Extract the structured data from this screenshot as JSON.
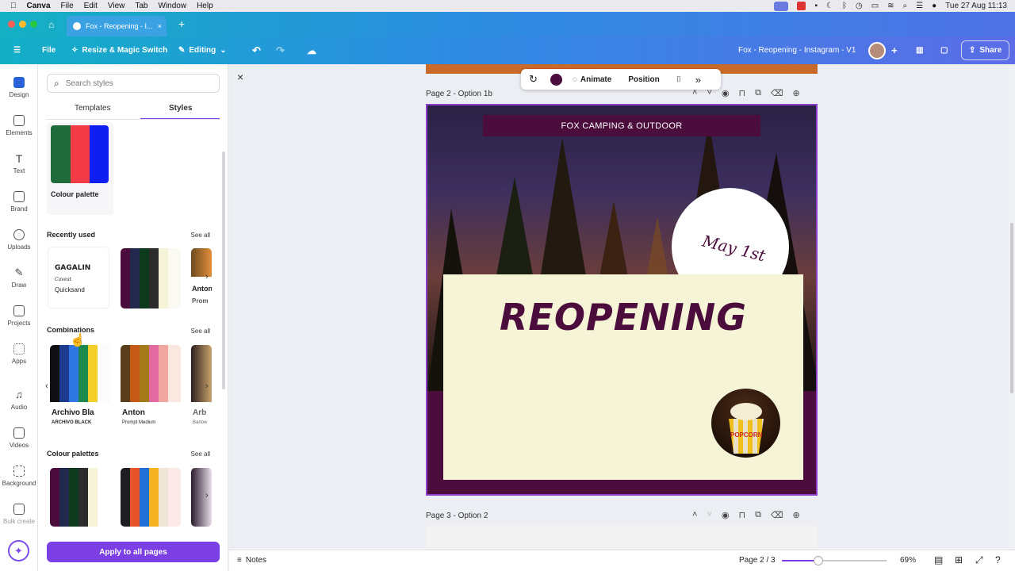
{
  "menubar": {
    "app": "Canva",
    "items": [
      "File",
      "Edit",
      "View",
      "Tab",
      "Window",
      "Help"
    ],
    "datetime": "Tue 27 Aug  11:13"
  },
  "tab": {
    "title": "Fox - Reopening - I...",
    "close": "×",
    "new": "+"
  },
  "toolbar": {
    "file": "File",
    "resize": "Resize & Magic Switch",
    "editing": "Editing",
    "doc_title": "Fox - Reopening - Instagram - V1",
    "share": "Share"
  },
  "sidebar": {
    "items": [
      "Design",
      "Elements",
      "Text",
      "Brand",
      "Uploads",
      "Draw",
      "Projects",
      "Apps",
      "Audio",
      "Videos",
      "Background",
      "Bulk create"
    ]
  },
  "panel": {
    "search_placeholder": "Search styles",
    "tabs": [
      "Templates",
      "Styles"
    ],
    "palette_label": "Colour palette",
    "recent": {
      "title": "Recently used",
      "see_all": "See all",
      "font_card": {
        "line1": "GAGALIN",
        "line2": "Caveat",
        "line3": "Quicksand"
      },
      "partial": {
        "line1": "Anton",
        "line2": "Prom"
      }
    },
    "combos": {
      "title": "Combinations",
      "see_all": "See all",
      "cards": [
        {
          "font": "Archivo Bla",
          "sub": "ARCHIVO BLACK"
        },
        {
          "font": "Anton",
          "sub": "Prompt Medium"
        },
        {
          "font": "Arb",
          "sub": "Barlow"
        }
      ]
    },
    "palettes": {
      "title": "Colour palettes",
      "see_all": "See all"
    },
    "apply": "Apply to all pages"
  },
  "canvas": {
    "ctx": {
      "animate": "Animate",
      "position": "Position",
      "color": "#4b0d3c"
    },
    "page2_label": "Page 2 - Option 1b",
    "page3_label": "Page 3 - Option 2",
    "design": {
      "banner": "FOX CAMPING & OUTDOOR",
      "date": "May 1st",
      "headline": "REOPENING",
      "popcorn_text": "POPCORN"
    }
  },
  "bottombar": {
    "notes": "Notes",
    "page": "Page 2 / 3",
    "zoom": "69%",
    "zoom_level": 0.69
  }
}
